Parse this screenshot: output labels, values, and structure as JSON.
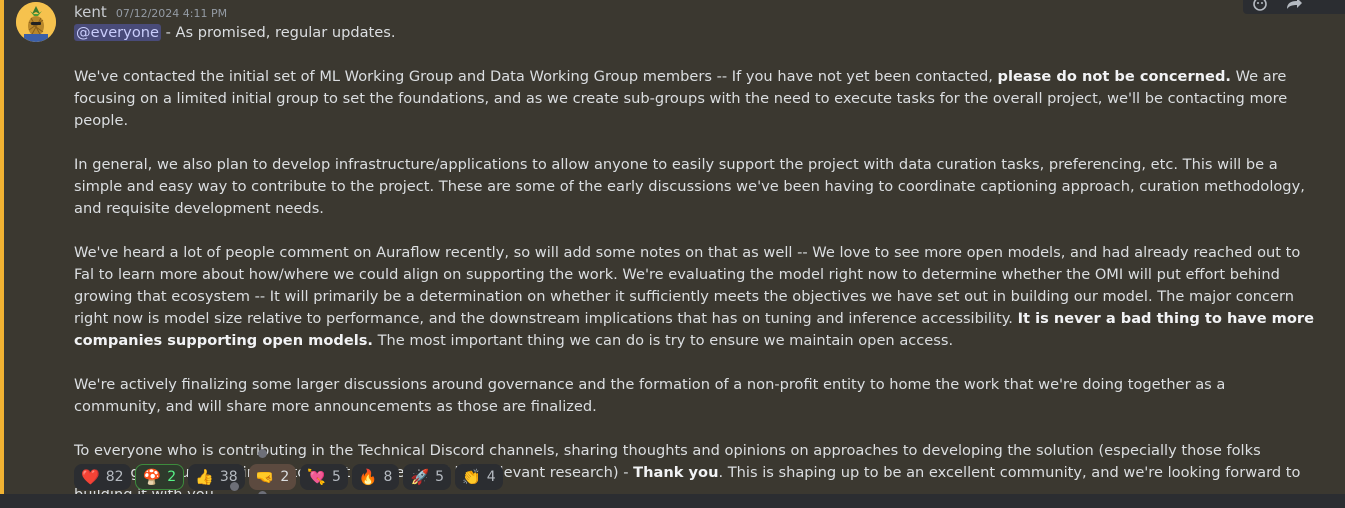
{
  "message": {
    "username": "kent",
    "timestamp": "07/12/2024 4:11 PM",
    "mention": "@everyone",
    "intro": " - As promised, regular updates.",
    "p1_a": "We've contacted the initial set of ML Working Group and Data Working Group members -- If you have not yet been contacted, ",
    "p1_b": "please do not be concerned.",
    "p1_c": " We are focusing on a limited initial group to set the foundations, and as we create sub-groups with the need to execute tasks for the overall project, we'll be contacting more people.",
    "p2": "In general, we also plan to develop infrastructure/applications to allow anyone to easily support the project with data curation tasks, preferencing, etc. This will be a simple and easy way to contribute to the project. These are some of the early discussions we've been having to coordinate captioning approach, curation methodology, and requisite development needs.",
    "p3_a": "We've heard a lot of people comment on Auraflow recently, so will add some notes on that as well -- We love to see more open models, and had already reached out to Fal to learn more about how/where we could align on supporting the work. We're evaluating the model right now to determine whether the OMI will put effort behind growing that ecosystem -- It will primarily be a determination on whether it sufficiently meets the objectives we have set out in building our model. The major concern right now is model size relative to performance, and the downstream implications that has on tuning and inference accessibility. ",
    "p3_b": "It is never a bad thing to have more companies supporting open models.",
    "p3_c": " The most important thing we can do is try to ensure we maintain open access.",
    "p4": "We're actively finalizing some larger discussions around governance and the formation of a non-profit entity to home the work that we're doing together as a community, and will share more announcements as those are finalized.",
    "p5_a": "To everyone who is contributing in the Technical Discord channels, sharing thoughts and opinions on approaches to developing the solution (especially those folks who've gone out of their way to scout datasets and link relevant research) - ",
    "p5_b": "Thank you",
    "p5_c": ". This is shaping up to be an excellent community, and we're looking forward to building it with you."
  },
  "reactions": [
    {
      "emoji": "❤️",
      "icon": "heart",
      "count": "82"
    },
    {
      "emoji": "🍄",
      "icon": "mushroom",
      "count": "2"
    },
    {
      "emoji": "👍",
      "icon": "thumbs-up",
      "count": "38"
    },
    {
      "emoji": "🤜",
      "icon": "fist-bump",
      "count": "2"
    },
    {
      "emoji": "💘",
      "icon": "heart-arrow",
      "count": "5"
    },
    {
      "emoji": "🔥",
      "icon": "fire",
      "count": "8"
    },
    {
      "emoji": "🚀",
      "icon": "rocket",
      "count": "5"
    },
    {
      "emoji": "👏",
      "icon": "clap",
      "count": "4"
    }
  ],
  "colors": {
    "background": "#3b3830",
    "mention_bar": "#f0b232",
    "mention_bg": "#494b79"
  }
}
